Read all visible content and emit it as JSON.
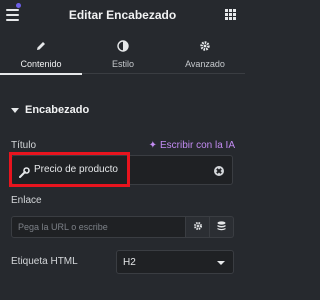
{
  "header": {
    "title": "Editar Encabezado"
  },
  "tabs": [
    {
      "label": "Contenido",
      "icon": "pencil-icon",
      "active": true
    },
    {
      "label": "Estilo",
      "icon": "half-circle-icon",
      "active": false
    },
    {
      "label": "Avanzado",
      "icon": "gear-icon",
      "active": false
    }
  ],
  "section": {
    "title": "Encabezado"
  },
  "fields": {
    "titulo": {
      "label": "Título",
      "ai_link": "Escribir con la IA",
      "value": "Precio de producto"
    },
    "enlace": {
      "label": "Enlace",
      "placeholder": "Pega la URL o escribe"
    },
    "etiqueta": {
      "label": "Etiqueta HTML",
      "value": "H2"
    }
  },
  "colors": {
    "accent_ai": "#c28bf2",
    "highlight": "#e8141e",
    "background": "#26292e"
  }
}
